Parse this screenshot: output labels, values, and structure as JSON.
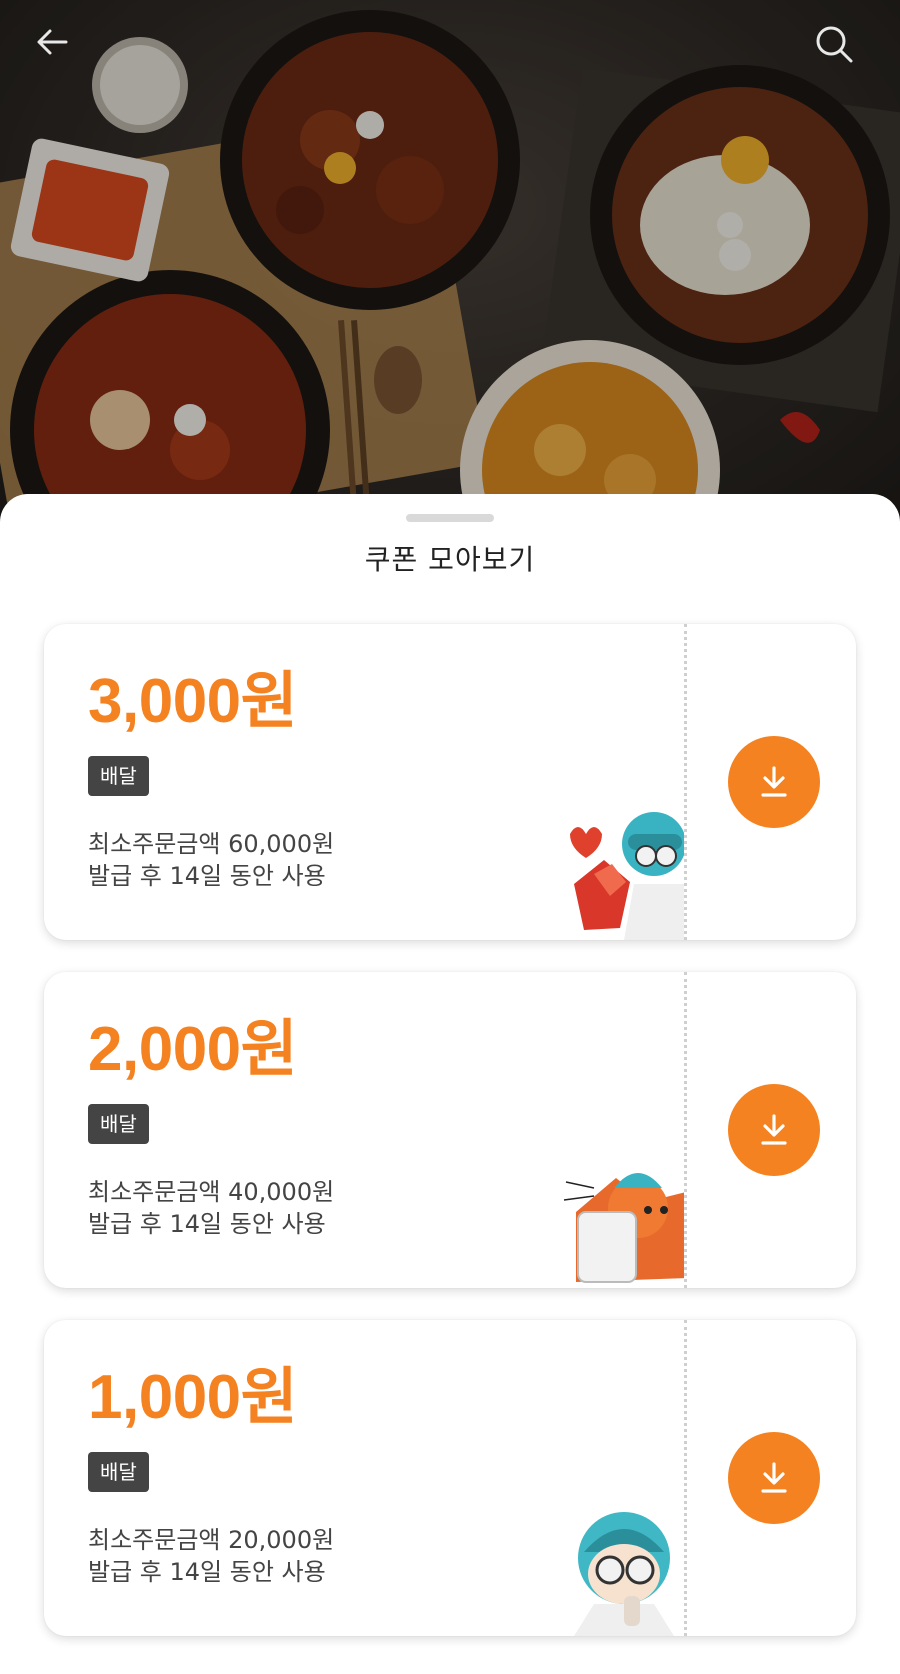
{
  "header": {
    "back_icon": "arrow-left-icon",
    "search_icon": "search-icon"
  },
  "sheet": {
    "title": "쿠폰 모아보기"
  },
  "colors": {
    "accent": "#f58220",
    "badge_bg": "#444444"
  },
  "coupons": [
    {
      "amount": "3,000원",
      "badge": "배달",
      "min_order": "최소주문금액 60,000원",
      "period": "발급 후 14일 동안 사용",
      "icon": "download-icon"
    },
    {
      "amount": "2,000원",
      "badge": "배달",
      "min_order": "최소주문금액 40,000원",
      "period": "발급 후 14일 동안 사용",
      "icon": "download-icon"
    },
    {
      "amount": "1,000원",
      "badge": "배달",
      "min_order": "최소주문금액 20,000원",
      "period": "발급 후 14일 동안 사용",
      "icon": "download-icon"
    }
  ]
}
